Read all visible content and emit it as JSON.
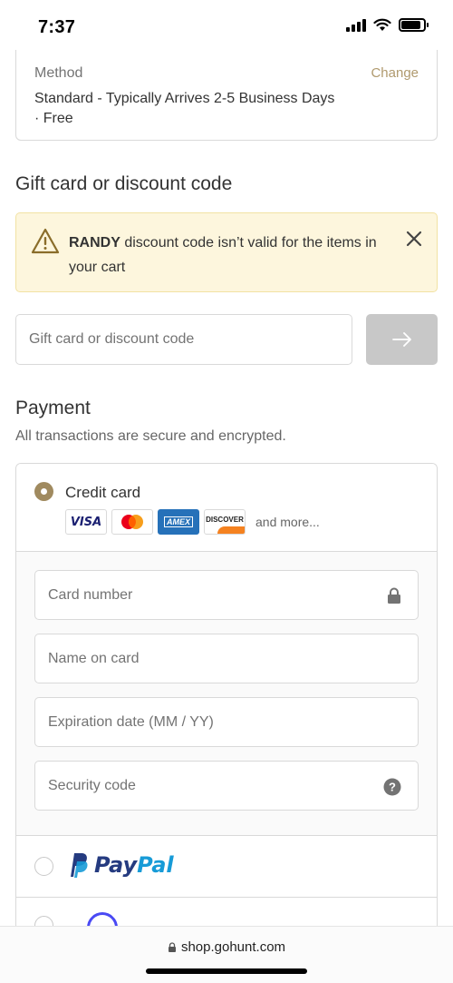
{
  "status_bar": {
    "time": "7:37"
  },
  "shipping": {
    "method_label": "Method",
    "change_label": "Change",
    "method_value": "Standard - Typically Arrives 2-5 Business Days",
    "method_price": "· Free"
  },
  "discount": {
    "title": "Gift card or discount code",
    "alert_code": "RANDY",
    "alert_message": "discount code isn’t valid for the items in your cart",
    "input_placeholder": "Gift card or discount code"
  },
  "payment": {
    "title": "Payment",
    "subtitle": "All transactions are secure and encrypted.",
    "credit_card": {
      "label": "Credit card",
      "selected": true,
      "card_logos": [
        "VISA",
        "mastercard",
        "AMEX",
        "DISCOVER"
      ],
      "and_more": "and more...",
      "fields": {
        "card_number": "Card number",
        "name_on_card": "Name on card",
        "expiration": "Expiration date (MM / YY)",
        "security_code": "Security code"
      }
    },
    "paypal": {
      "label_part1": "Pay",
      "label_part2": "Pal",
      "selected": false
    },
    "affirm": {
      "selected": false
    }
  },
  "browser": {
    "url": "shop.gohunt.com"
  },
  "colors": {
    "accent": "#a08a5f",
    "link": "#b09a6e",
    "alert_bg": "#fdf6dd",
    "button_disabled": "#c8c8c8",
    "paypal_dark": "#253b80",
    "paypal_light": "#179bd7"
  }
}
